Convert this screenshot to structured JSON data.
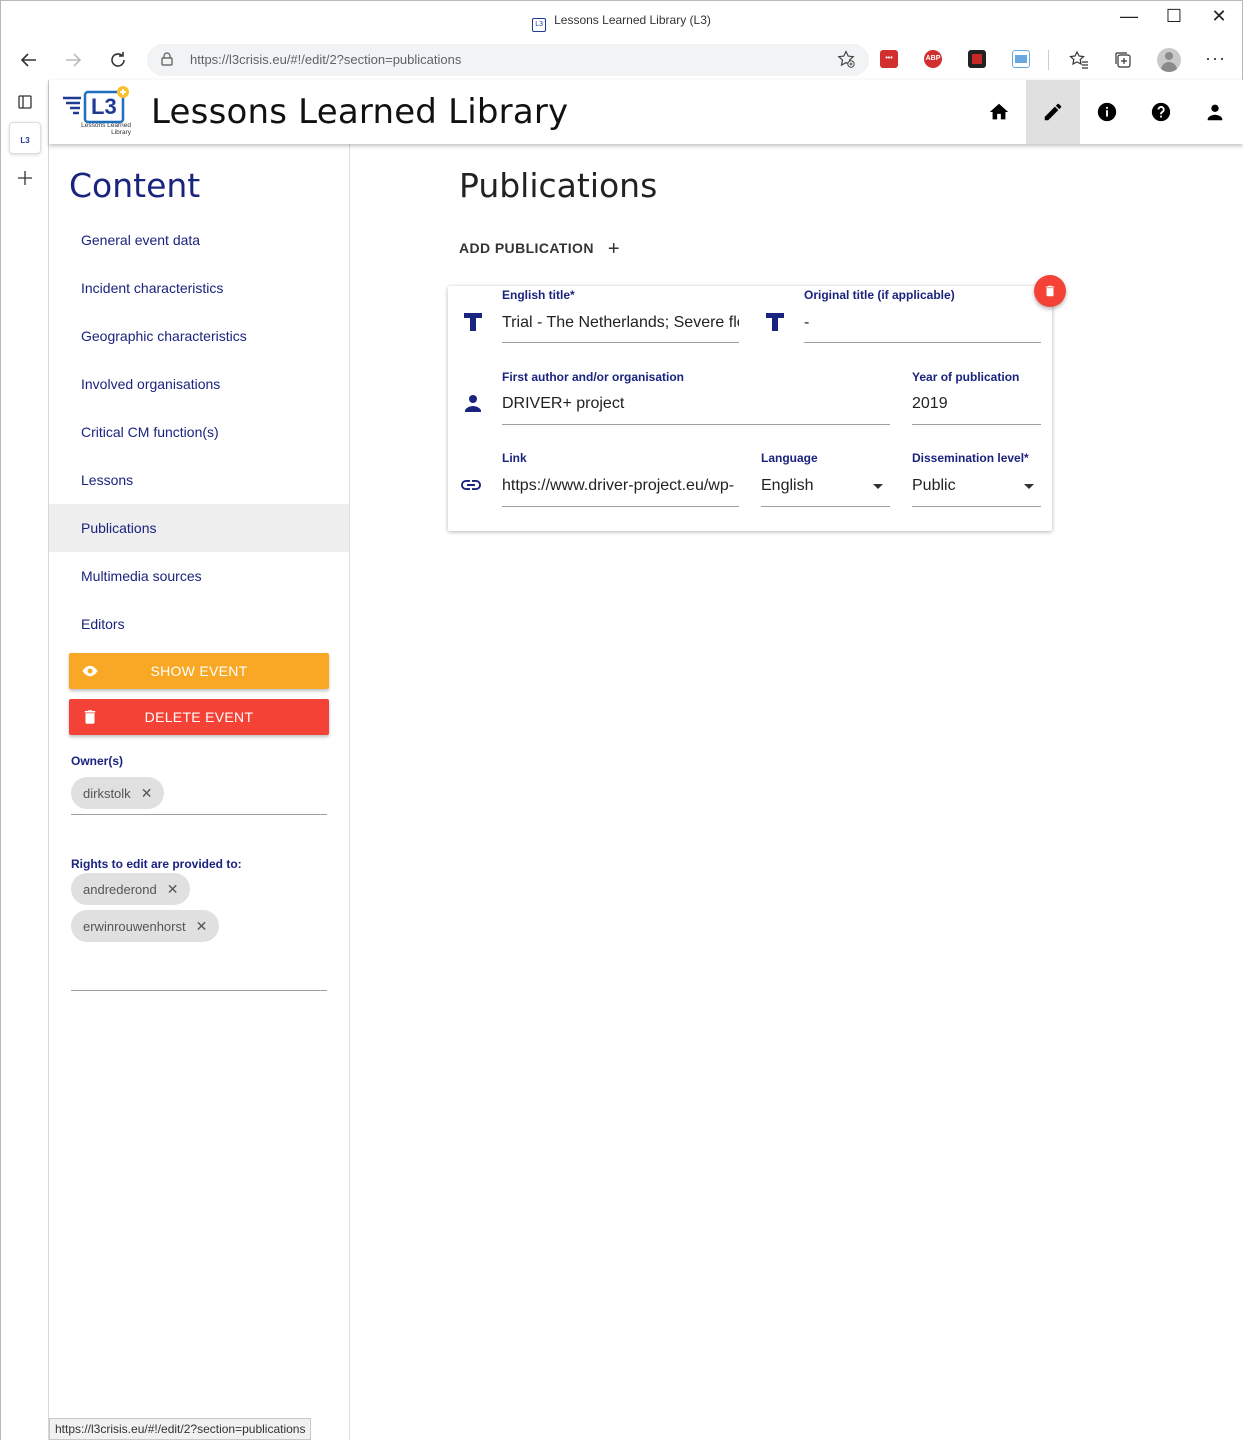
{
  "window": {
    "title": "Lessons Learned Library (L3)",
    "favicon_text": "L3",
    "minimize": "—",
    "maximize": "☐",
    "close": "✕"
  },
  "browser": {
    "url": "https://l3crisis.eu/#!/edit/2?section=publications",
    "status_url": "https://l3crisis.eu/#!/edit/2?section=publications",
    "extensions": [
      "lastpass",
      "adblock-plus",
      "extension",
      "reader"
    ],
    "extension_labels": {
      "adblock": "ABP"
    }
  },
  "app": {
    "title": "Lessons Learned Library",
    "logo_text": "L3",
    "logo_subtitle": "Lessons Learned Library",
    "nav": [
      "home",
      "edit",
      "info",
      "help",
      "account"
    ]
  },
  "sidebar": {
    "heading": "Content",
    "items": [
      {
        "label": "General event data"
      },
      {
        "label": "Incident characteristics"
      },
      {
        "label": "Geographic characteristics"
      },
      {
        "label": "Involved organisations"
      },
      {
        "label": "Critical CM function(s)"
      },
      {
        "label": "Lessons"
      },
      {
        "label": "Publications",
        "active": true
      },
      {
        "label": "Multimedia sources"
      },
      {
        "label": "Editors"
      }
    ],
    "show_event_label": "SHOW EVENT",
    "delete_event_label": "DELETE EVENT",
    "owners_label": "Owner(s)",
    "owners": [
      "dirkstolk"
    ],
    "rights_label": "Rights to edit are provided to:",
    "editors": [
      "andrederond",
      "erwinrouwenhorst"
    ],
    "colors": {
      "show": "#f9a825",
      "delete": "#f44336",
      "text": "#1a237e"
    }
  },
  "main": {
    "heading": "Publications",
    "add_label": "ADD PUBLICATION",
    "add_icon": "+",
    "publication": {
      "english_title_label": "English title*",
      "english_title": "Trial - The Netherlands; Severe flo",
      "original_title_label": "Original title (if applicable)",
      "original_title": "-",
      "author_label": "First author and/or organisation",
      "author": "DRIVER+ project",
      "year_label": "Year of publication",
      "year": "2019",
      "link_label": "Link",
      "link": "https://www.driver-project.eu/wp-",
      "language_label": "Language",
      "language": "English",
      "dissemination_label": "Dissemination level*",
      "dissemination": "Public"
    }
  }
}
